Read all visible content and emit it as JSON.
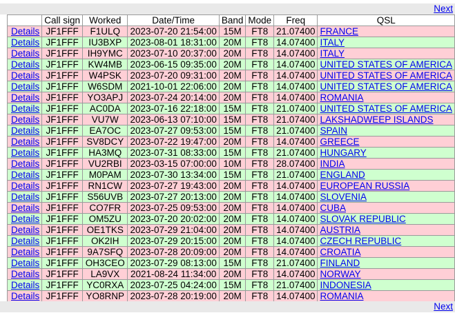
{
  "nav": {
    "next_label": "Next"
  },
  "table": {
    "columns": [
      "",
      "Call sign",
      "Worked",
      "Date/Time",
      "Band",
      "Mode",
      "Freq",
      "QSL"
    ],
    "details_label": "Details",
    "rows": [
      {
        "call": "JF1FFF",
        "worked": "F1ULQ",
        "datetime": "2023-07-20 21:54:00",
        "band": "15M",
        "mode": "FT8",
        "freq": "21.07400",
        "qsl": "FRANCE",
        "status": "pink"
      },
      {
        "call": "JF1FFF",
        "worked": "IU3BXP",
        "datetime": "2023-08-01 18:31:00",
        "band": "20M",
        "mode": "FT8",
        "freq": "14.07400",
        "qsl": "ITALY",
        "status": "green"
      },
      {
        "call": "JF1FFF",
        "worked": "IH9YMC",
        "datetime": "2023-07-10 20:37:00",
        "band": "20M",
        "mode": "FT8",
        "freq": "14.07400",
        "qsl": "ITALY",
        "status": "pink"
      },
      {
        "call": "JF1FFF",
        "worked": "KW4MB",
        "datetime": "2023-06-15 09:35:00",
        "band": "20M",
        "mode": "FT8",
        "freq": "14.07400",
        "qsl": "UNITED STATES OF AMERICA",
        "status": "green"
      },
      {
        "call": "JF1FFF",
        "worked": "W4PSK",
        "datetime": "2023-07-20 09:31:00",
        "band": "20M",
        "mode": "FT8",
        "freq": "14.07400",
        "qsl": "UNITED STATES OF AMERICA",
        "status": "pink"
      },
      {
        "call": "JF1FFF",
        "worked": "W6SDM",
        "datetime": "2021-10-01 22:06:00",
        "band": "20M",
        "mode": "FT8",
        "freq": "14.07400",
        "qsl": "UNITED STATES OF AMERICA",
        "status": "green"
      },
      {
        "call": "JF1FFF",
        "worked": "YO3APJ",
        "datetime": "2023-07-24 20:14:00",
        "band": "20M",
        "mode": "FT8",
        "freq": "14.07400",
        "qsl": "ROMANIA",
        "status": "pink"
      },
      {
        "call": "JF1FFF",
        "worked": "AC0DA",
        "datetime": "2023-07-16 22:18:00",
        "band": "15M",
        "mode": "FT8",
        "freq": "21.07400",
        "qsl": "UNITED STATES OF AMERICA",
        "status": "green"
      },
      {
        "call": "JF1FFF",
        "worked": "VU7W",
        "datetime": "2023-06-13 07:10:00",
        "band": "15M",
        "mode": "FT8",
        "freq": "21.07400",
        "qsl": "LAKSHADWEEP ISLANDS",
        "status": "pink"
      },
      {
        "call": "JF1FFF",
        "worked": "EA7OC",
        "datetime": "2023-07-27 09:53:00",
        "band": "15M",
        "mode": "FT8",
        "freq": "21.07400",
        "qsl": "SPAIN",
        "status": "green"
      },
      {
        "call": "JF1FFF",
        "worked": "SV8DCY",
        "datetime": "2023-07-22 19:47:00",
        "band": "20M",
        "mode": "FT8",
        "freq": "14.07400",
        "qsl": "GREECE",
        "status": "pink"
      },
      {
        "call": "JF1FFF",
        "worked": "HA3MQ",
        "datetime": "2023-07-31 08:33:00",
        "band": "15M",
        "mode": "FT8",
        "freq": "21.07400",
        "qsl": "HUNGARY",
        "status": "green"
      },
      {
        "call": "JF1FFF",
        "worked": "VU2RBI",
        "datetime": "2023-03-15 07:00:00",
        "band": "10M",
        "mode": "FT8",
        "freq": "28.07400",
        "qsl": "INDIA",
        "status": "pink"
      },
      {
        "call": "JF1FFF",
        "worked": "M0PAM",
        "datetime": "2023-07-30 13:34:00",
        "band": "15M",
        "mode": "FT8",
        "freq": "21.07400",
        "qsl": "ENGLAND",
        "status": "green"
      },
      {
        "call": "JF1FFF",
        "worked": "RN1CW",
        "datetime": "2023-07-27 19:43:00",
        "band": "20M",
        "mode": "FT8",
        "freq": "14.07400",
        "qsl": "EUROPEAN RUSSIA",
        "status": "pink"
      },
      {
        "call": "JF1FFF",
        "worked": "S56UVB",
        "datetime": "2023-07-27 20:13:00",
        "band": "20M",
        "mode": "FT8",
        "freq": "14.07400",
        "qsl": "SLOVENIA",
        "status": "green"
      },
      {
        "call": "JF1FFF",
        "worked": "CO7FR",
        "datetime": "2023-07-25 09:53:00",
        "band": "20M",
        "mode": "FT8",
        "freq": "14.07400",
        "qsl": "CUBA",
        "status": "pink"
      },
      {
        "call": "JF1FFF",
        "worked": "OM5ZU",
        "datetime": "2023-07-20 20:02:00",
        "band": "20M",
        "mode": "FT8",
        "freq": "14.07400",
        "qsl": "SLOVAK REPUBLIC",
        "status": "green"
      },
      {
        "call": "JF1FFF",
        "worked": "OE1TKS",
        "datetime": "2023-07-29 21:04:00",
        "band": "20M",
        "mode": "FT8",
        "freq": "14.07400",
        "qsl": "AUSTRIA",
        "status": "pink"
      },
      {
        "call": "JF1FFF",
        "worked": "OK2IH",
        "datetime": "2023-07-29 20:15:00",
        "band": "20M",
        "mode": "FT8",
        "freq": "14.07400",
        "qsl": "CZECH REPUBLIC",
        "status": "green"
      },
      {
        "call": "JF1FFF",
        "worked": "9A7SFQ",
        "datetime": "2023-07-28 20:09:00",
        "band": "20M",
        "mode": "FT8",
        "freq": "14.07400",
        "qsl": "CROATIA",
        "status": "pink"
      },
      {
        "call": "JF1FFF",
        "worked": "OH3CEO",
        "datetime": "2023-07-29 08:13:00",
        "band": "15M",
        "mode": "FT8",
        "freq": "21.07400",
        "qsl": "FINLAND",
        "status": "green"
      },
      {
        "call": "JF1FFF",
        "worked": "LA9VX",
        "datetime": "2021-08-24 11:34:00",
        "band": "20M",
        "mode": "FT8",
        "freq": "14.07400",
        "qsl": "NORWAY",
        "status": "pink"
      },
      {
        "call": "JF1FFF",
        "worked": "YC0RXA",
        "datetime": "2023-07-25 04:24:00",
        "band": "15M",
        "mode": "FT8",
        "freq": "21.07400",
        "qsl": "INDONESIA",
        "status": "green"
      },
      {
        "call": "JF1FFF",
        "worked": "YO8RNP",
        "datetime": "2023-07-28 20:19:00",
        "band": "20M",
        "mode": "FT8",
        "freq": "14.07400",
        "qsl": "ROMANIA",
        "status": "pink"
      }
    ]
  },
  "colors": {
    "row_pink": "#ffcfd6",
    "row_green": "#cfffcf",
    "link": "#0000ee",
    "nav_bar": "#e9e9e9",
    "grid": "#9a9a9a"
  }
}
